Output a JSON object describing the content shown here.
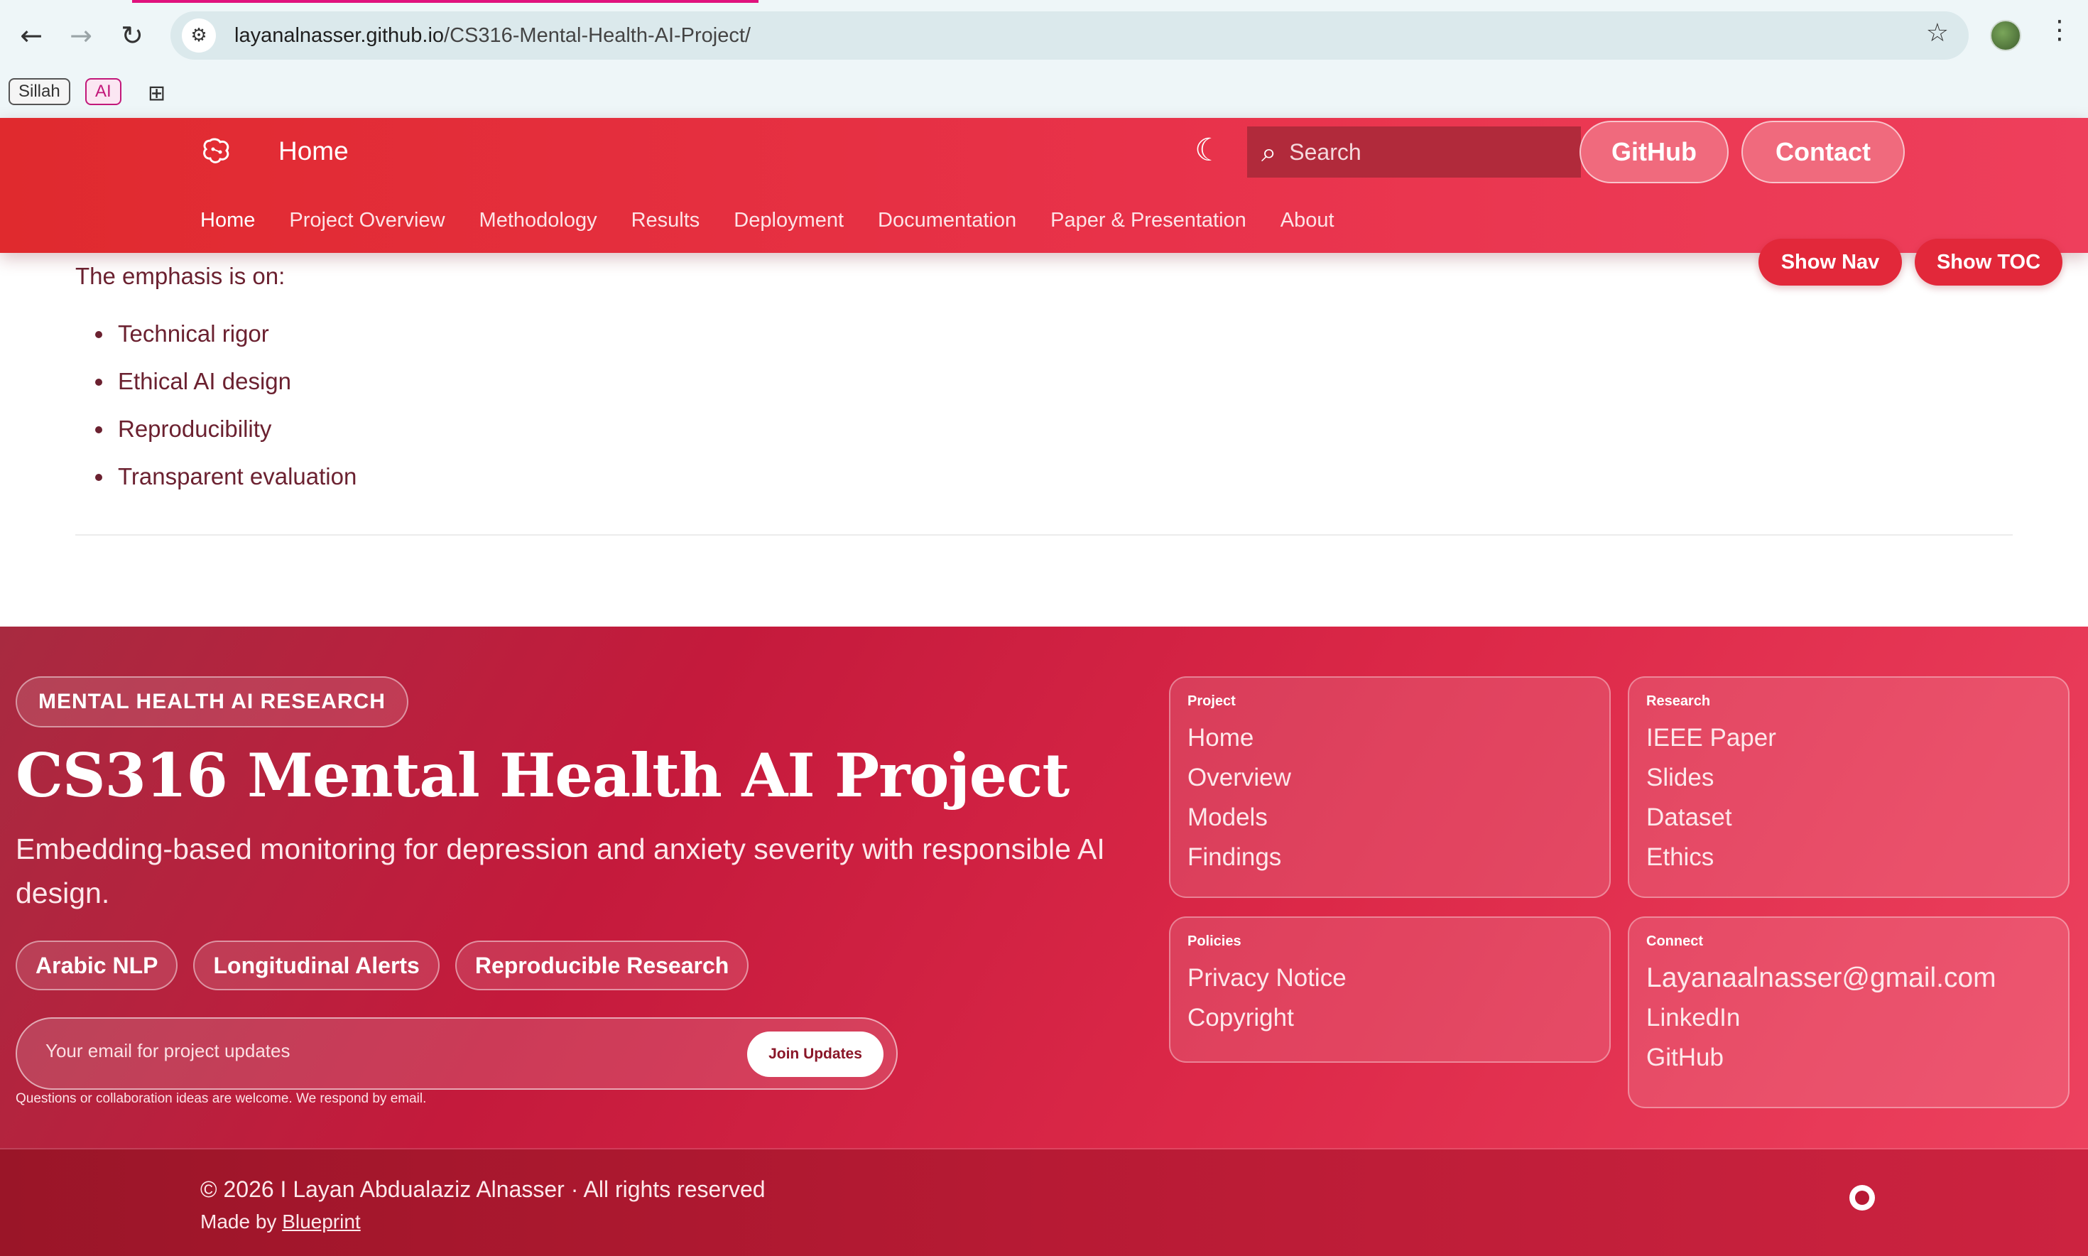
{
  "browser": {
    "url_host": "layanalnasser.github.io",
    "url_path": "/CS316-Mental-Health-AI-Project/",
    "bookmarks": [
      {
        "label": "Sillah"
      },
      {
        "label": "AI"
      }
    ],
    "load_progress": 0.3,
    "icons": {
      "back": "back-arrow-icon",
      "forward": "forward-arrow-icon",
      "reload": "reload-icon",
      "star": "star-icon",
      "menu": "kebab-menu-icon",
      "apps": "apps-grid-icon"
    }
  },
  "header": {
    "title": "Home",
    "search_placeholder": "Search",
    "github_label": "GitHub",
    "contact_label": "Contact",
    "nav": [
      {
        "label": "Home",
        "active": true
      },
      {
        "label": "Project Overview"
      },
      {
        "label": "Methodology"
      },
      {
        "label": "Results"
      },
      {
        "label": "Deployment"
      },
      {
        "label": "Documentation"
      },
      {
        "label": "Paper & Presentation"
      },
      {
        "label": "About"
      }
    ],
    "show_nav_label": "Show Nav",
    "show_toc_label": "Show TOC"
  },
  "main": {
    "emphasis_intro": "The emphasis is on:",
    "emphasis_items": [
      "Technical rigor",
      "Ethical AI design",
      "Reproducibility",
      "Transparent evaluation"
    ]
  },
  "footer": {
    "tagline": "MENTAL HEALTH AI RESEARCH",
    "title": "CS316 Mental Health AI Project",
    "description": "Embedding-based monitoring for depression and anxiety severity with responsible AI design.",
    "chips": [
      "Arabic NLP",
      "Longitudinal Alerts",
      "Reproducible Research"
    ],
    "subscribe_placeholder": "Your email for project updates",
    "join_label": "Join Updates",
    "subscribe_note": "Questions or collaboration ideas are welcome. We respond by email.",
    "cards": {
      "project": {
        "title": "Project",
        "links": [
          "Home",
          "Overview",
          "Models",
          "Findings"
        ]
      },
      "research": {
        "title": "Research",
        "links": [
          "IEEE Paper",
          "Slides",
          "Dataset",
          "Ethics"
        ]
      },
      "policies": {
        "title": "Policies",
        "links": [
          "Privacy Notice",
          "Copyright"
        ]
      },
      "connect": {
        "title": "Connect",
        "links": [
          "Layanaalnasser@gmail.com",
          "LinkedIn",
          "GitHub"
        ]
      }
    },
    "copyright": "© 2026 I Layan Abdualaziz Alnasser · All rights reserved",
    "made_by_prefix": "Made by",
    "made_by_link": "Blueprint"
  },
  "colors": {
    "header_red": "#e02a2e",
    "accent_red": "#e2283a",
    "footer_crimson": "#c41a3c"
  }
}
